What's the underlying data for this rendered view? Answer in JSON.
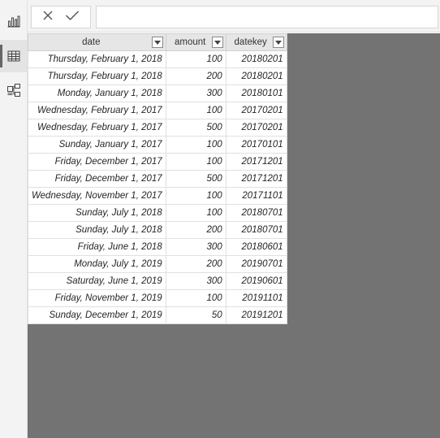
{
  "nav": {
    "items": [
      {
        "id": "report",
        "icon": "bar-chart-icon",
        "active": false
      },
      {
        "id": "data",
        "icon": "table-icon",
        "active": true
      },
      {
        "id": "model",
        "icon": "model-relationship-icon",
        "active": false
      }
    ]
  },
  "formula_bar": {
    "cancel_icon": "close-icon",
    "commit_icon": "checkmark-icon",
    "value": ""
  },
  "table": {
    "columns": [
      {
        "key": "date",
        "label": "date"
      },
      {
        "key": "amount",
        "label": "amount"
      },
      {
        "key": "datekey",
        "label": "datekey"
      }
    ],
    "rows": [
      {
        "date": "Thursday, February 1, 2018",
        "amount": "100",
        "datekey": "20180201"
      },
      {
        "date": "Thursday, February 1, 2018",
        "amount": "200",
        "datekey": "20180201"
      },
      {
        "date": "Monday, January 1, 2018",
        "amount": "300",
        "datekey": "20180101"
      },
      {
        "date": "Wednesday, February 1, 2017",
        "amount": "100",
        "datekey": "20170201"
      },
      {
        "date": "Wednesday, February 1, 2017",
        "amount": "500",
        "datekey": "20170201"
      },
      {
        "date": "Sunday, January 1, 2017",
        "amount": "100",
        "datekey": "20170101"
      },
      {
        "date": "Friday, December 1, 2017",
        "amount": "100",
        "datekey": "20171201"
      },
      {
        "date": "Friday, December 1, 2017",
        "amount": "500",
        "datekey": "20171201"
      },
      {
        "date": "Wednesday, November 1, 2017",
        "amount": "100",
        "datekey": "20171101"
      },
      {
        "date": "Sunday, July 1, 2018",
        "amount": "100",
        "datekey": "20180701"
      },
      {
        "date": "Sunday, July 1, 2018",
        "amount": "200",
        "datekey": "20180701"
      },
      {
        "date": "Friday, June 1, 2018",
        "amount": "300",
        "datekey": "20180601"
      },
      {
        "date": "Monday, July 1, 2019",
        "amount": "200",
        "datekey": "20190701"
      },
      {
        "date": "Saturday, June 1, 2019",
        "amount": "300",
        "datekey": "20190601"
      },
      {
        "date": "Friday, November 1, 2019",
        "amount": "100",
        "datekey": "20191101"
      },
      {
        "date": "Sunday, December 1, 2019",
        "amount": "50",
        "datekey": "20191201"
      }
    ]
  },
  "colors": {
    "canvas": "#737373",
    "header_bg": "#e6e6e6",
    "nav_bg": "#f3f3f3"
  }
}
